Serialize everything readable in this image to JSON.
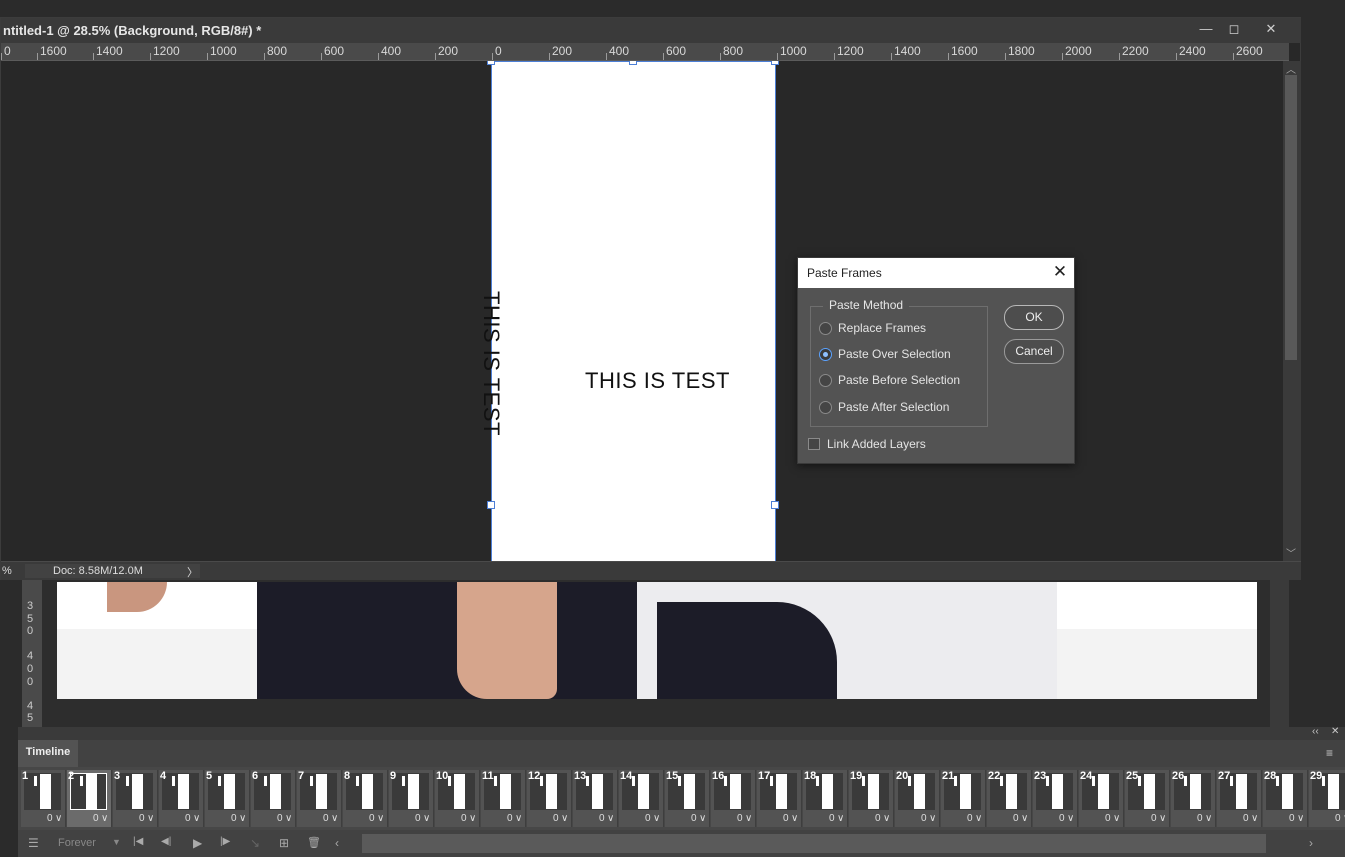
{
  "document": {
    "title": "ntitled-1 @ 28.5% (Background, RGB/8#) *",
    "window_buttons": {
      "minimize": "—",
      "maximize": "◻",
      "close": "✕"
    },
    "ruler_labels": [
      "0",
      "1600",
      "1400",
      "1200",
      "1000",
      "800",
      "600",
      "400",
      "200",
      "0",
      "200",
      "400",
      "600",
      "800",
      "1000",
      "1200",
      "1400",
      "1600",
      "1800",
      "2000",
      "2200",
      "2400",
      "2600"
    ],
    "canvas_text_vertical": "THIS IS TEST",
    "canvas_text_horizontal": "THIS IS TEST",
    "status_zoom": "%",
    "status_doc": "Doc: 8.58M/12.0M",
    "status_arrow": "〉",
    "scroll_up": "︿",
    "scroll_down": "﹀"
  },
  "doc2": {
    "vertical_ruler_digits": [
      "3",
      "5",
      "0",
      "4",
      "0",
      "0",
      "4",
      "5"
    ]
  },
  "dialog": {
    "title": "Paste Frames",
    "close_icon": "✕",
    "group_label": "Paste Method",
    "options": [
      {
        "label": "Replace Frames",
        "selected": false
      },
      {
        "label": "Paste Over Selection",
        "selected": true
      },
      {
        "label": "Paste Before Selection",
        "selected": false
      },
      {
        "label": "Paste After Selection",
        "selected": false
      }
    ],
    "ok_label": "OK",
    "cancel_label": "Cancel",
    "link_label": "Link Added Layers",
    "link_checked": false
  },
  "timeline": {
    "tab_label": "Timeline",
    "collapse_icon": "‹‹",
    "close_icon": "✕",
    "menu_icon": "≡",
    "frames": [
      {
        "num": "1",
        "delay": "0"
      },
      {
        "num": "2",
        "delay": "0"
      },
      {
        "num": "3",
        "delay": "0"
      },
      {
        "num": "4",
        "delay": "0"
      },
      {
        "num": "5",
        "delay": "0"
      },
      {
        "num": "6",
        "delay": "0"
      },
      {
        "num": "7",
        "delay": "0"
      },
      {
        "num": "8",
        "delay": "0"
      },
      {
        "num": "9",
        "delay": "0"
      },
      {
        "num": "10",
        "delay": "0"
      },
      {
        "num": "11",
        "delay": "0"
      },
      {
        "num": "12",
        "delay": "0"
      },
      {
        "num": "13",
        "delay": "0"
      },
      {
        "num": "14",
        "delay": "0"
      },
      {
        "num": "15",
        "delay": "0"
      },
      {
        "num": "16",
        "delay": "0"
      },
      {
        "num": "17",
        "delay": "0"
      },
      {
        "num": "18",
        "delay": "0"
      },
      {
        "num": "19",
        "delay": "0"
      },
      {
        "num": "20",
        "delay": "0"
      },
      {
        "num": "21",
        "delay": "0"
      },
      {
        "num": "22",
        "delay": "0"
      },
      {
        "num": "23",
        "delay": "0"
      },
      {
        "num": "24",
        "delay": "0"
      },
      {
        "num": "25",
        "delay": "0"
      },
      {
        "num": "26",
        "delay": "0"
      },
      {
        "num": "27",
        "delay": "0"
      },
      {
        "num": "28",
        "delay": "0"
      },
      {
        "num": "29",
        "delay": "0"
      }
    ],
    "selected_frame": "2",
    "loop_value": "Forever",
    "loop_arrow": "▼",
    "controls": {
      "convert_icon": "☰",
      "first_frame_icon": "|◀",
      "prev_frame_icon": "◀|",
      "play_icon": "▶",
      "next_frame_icon": "|▶",
      "tween_icon": "↘",
      "new_frame_icon": "⊞",
      "delete_icon": "🗑",
      "scroll_left": "‹",
      "scroll_right": "›"
    }
  }
}
